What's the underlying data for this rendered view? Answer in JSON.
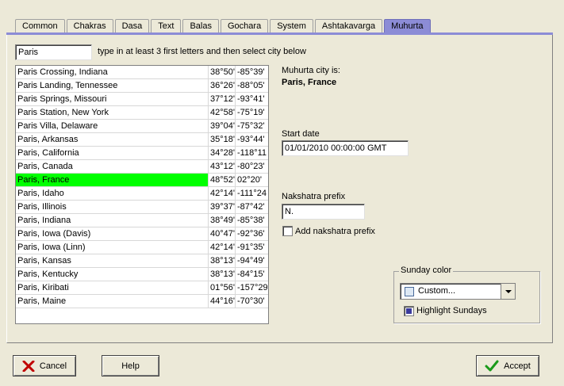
{
  "tabs": [
    "Common",
    "Chakras",
    "Dasa",
    "Text",
    "Balas",
    "Gochara",
    "System",
    "Ashtakavarga",
    "Muhurta"
  ],
  "active_tab": "Muhurta",
  "city_search": {
    "value": "Paris",
    "hint": "type in at least 3 first letters and then select city  below"
  },
  "cities": [
    {
      "name": "Paris Crossing, Indiana",
      "lat": "38°50'",
      "lon": "-85°39'"
    },
    {
      "name": "Paris Landing, Tennessee",
      "lat": "36°26'",
      "lon": "-88°05'"
    },
    {
      "name": "Paris Springs, Missouri",
      "lat": "37°12'",
      "lon": "-93°41'"
    },
    {
      "name": "Paris Station, New York",
      "lat": "42°58'",
      "lon": "-75°19'"
    },
    {
      "name": "Paris Villa, Delaware",
      "lat": "39°04'",
      "lon": "-75°32'"
    },
    {
      "name": "Paris, Arkansas",
      "lat": "35°18'",
      "lon": "-93°44'"
    },
    {
      "name": "Paris, California",
      "lat": "34°28'",
      "lon": "-118°11"
    },
    {
      "name": "Paris, Canada",
      "lat": "43°12'",
      "lon": "-80°23'"
    },
    {
      "name": "Paris, France",
      "lat": "48°52'",
      "lon": "02°20'"
    },
    {
      "name": "Paris, Idaho",
      "lat": "42°14'",
      "lon": "-111°24"
    },
    {
      "name": "Paris, Illinois",
      "lat": "39°37'",
      "lon": "-87°42'"
    },
    {
      "name": "Paris, Indiana",
      "lat": "38°49'",
      "lon": "-85°38'"
    },
    {
      "name": "Paris, Iowa (Davis)",
      "lat": "40°47'",
      "lon": "-92°36'"
    },
    {
      "name": "Paris, Iowa (Linn)",
      "lat": "42°14'",
      "lon": "-91°35'"
    },
    {
      "name": "Paris, Kansas",
      "lat": "38°13'",
      "lon": "-94°49'"
    },
    {
      "name": "Paris, Kentucky",
      "lat": "38°13'",
      "lon": "-84°15'"
    },
    {
      "name": "Paris, Kiribati",
      "lat": "01°56'",
      "lon": "-157°29"
    },
    {
      "name": "Paris, Maine",
      "lat": "44°16'",
      "lon": "-70°30'"
    }
  ],
  "selected_city": "Paris, France",
  "muhurta_city": {
    "label": "Muhurta city is:",
    "value": "Paris, France"
  },
  "start_date": {
    "label": "Start date",
    "value": "01/01/2010    00:00:00  GMT"
  },
  "nakshatra_prefix": {
    "label": "Nakshatra prefix",
    "value": "N."
  },
  "add_nakshatra_prefix": {
    "label": "Add nakshatra prefix",
    "checked": false
  },
  "sunday_color": {
    "title": "Sunday color",
    "selected": "Custom...",
    "swatch_color": "#dde8f4",
    "highlight_label": "Highlight Sundays",
    "highlight_checked": true
  },
  "buttons": {
    "cancel": "Cancel",
    "help": "Help",
    "accept": "Accept"
  },
  "colors": {
    "tab_accent": "#8c8cd6",
    "selected_row": "#00ff00",
    "background": "#ece9d8"
  }
}
